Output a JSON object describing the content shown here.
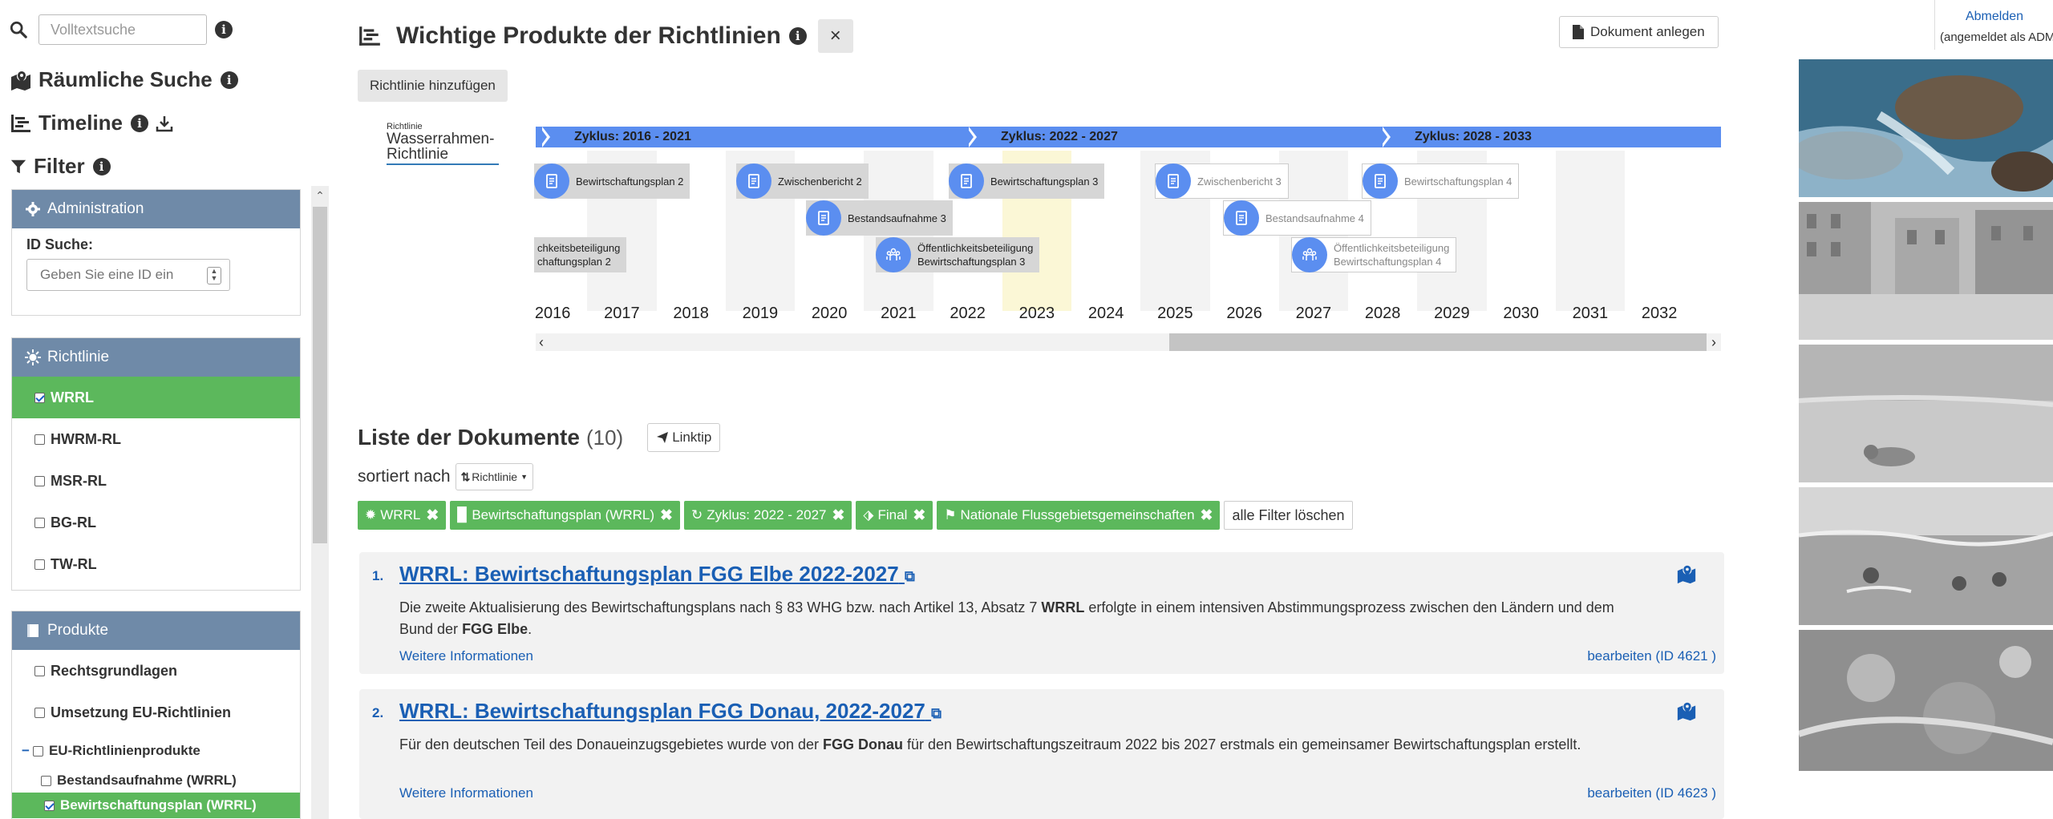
{
  "sidebar": {
    "search": {
      "placeholder": "Volltextsuche"
    },
    "spatial_search": "Räumliche Suche",
    "timeline": "Timeline",
    "filter": "Filter",
    "admin": {
      "title": "Administration",
      "id_label": "ID Suche:",
      "id_placeholder": "Geben Sie eine ID ein"
    },
    "richtlinie": {
      "title": "Richtlinie",
      "items": [
        {
          "label": "WRRL",
          "checked": true
        },
        {
          "label": "HWRM-RL",
          "checked": false
        },
        {
          "label": "MSR-RL",
          "checked": false
        },
        {
          "label": "BG-RL",
          "checked": false
        },
        {
          "label": "TW-RL",
          "checked": false
        }
      ]
    },
    "produkte": {
      "title": "Produkte",
      "items": [
        {
          "label": "Rechtsgrundlagen",
          "checked": false
        },
        {
          "label": "Umsetzung EU-Richtlinien",
          "checked": false
        },
        {
          "label": "EU-Richtlinienprodukte",
          "checked": false,
          "collapse": "−"
        },
        {
          "label": "Bestandsaufnahme (WRRL)",
          "checked": false
        },
        {
          "label": "Bewirtschaftungsplan (WRRL)",
          "checked": true
        }
      ]
    }
  },
  "main": {
    "title": "Wichtige Produkte der Richtlinien",
    "close": "×",
    "new_doc": "Dokument anlegen",
    "add_directive": "Richtlinie hinzufügen",
    "timeline": {
      "label_small": "Richtlinie",
      "label_big": "Wasserrahmen-Richtlinie",
      "cycles": [
        "Zyklus: 2016 - 2021",
        "Zyklus: 2022 - 2027",
        "Zyklus: 2028 - 2033"
      ],
      "years": [
        "2016",
        "2017",
        "2018",
        "2019",
        "2020",
        "2021",
        "2022",
        "2023",
        "2024",
        "2025",
        "2026",
        "2027",
        "2028",
        "2029",
        "2030",
        "2031",
        "2032"
      ],
      "current_year": "2023",
      "items": [
        {
          "label": "Bewirtschaftungsplan 2",
          "icon": "doc-icon",
          "future": false
        },
        {
          "label": "Zwischenbericht 2",
          "icon": "doc-icon",
          "future": false
        },
        {
          "label": "Bestandsaufnahme 3",
          "icon": "doc-icon",
          "future": false
        },
        {
          "label": "Bewirtschaftungsplan 3",
          "icon": "doc-icon",
          "future": false
        },
        {
          "label": "Zwischenbericht 3",
          "icon": "doc-icon",
          "future": true
        },
        {
          "label": "Bestandsaufnahme 4",
          "icon": "doc-icon",
          "future": true
        },
        {
          "label": "Bewirtschaftungsplan 4",
          "icon": "doc-icon",
          "future": true
        },
        {
          "line1": "chkeitsbeteiligung",
          "line2": "chaftungsplan 2",
          "icon": "none",
          "future": false
        },
        {
          "line1": "Öffentlichkeitsbeteiligung",
          "line2": "Bewirtschaftungsplan 3",
          "icon": "people-icon",
          "future": false
        },
        {
          "line1": "Öffentlichkeitsbeteiligung",
          "line2": "Bewirtschaftungsplan 4",
          "icon": "people-icon",
          "future": true
        }
      ]
    },
    "list": {
      "title": "Liste der Dokumente",
      "count": "(10)",
      "linktip": "Linktip",
      "sorted_by": "sortiert nach",
      "sort_value": "Richtlinie",
      "chips": [
        "WRRL",
        "Bewirtschaftungsplan (WRRL)",
        "Zyklus: 2022 - 2027",
        "Final",
        "Nationale Flussgebietsgemeinschaften"
      ],
      "clear_filters": "alle Filter löschen",
      "docs": [
        {
          "num": "1.",
          "title": "WRRL: Bewirtschaftungsplan FGG Elbe 2022-2027",
          "desc_a": "Die zweite Aktualisierung des Bewirtschaftungsplans nach § 83 WHG bzw. nach Artikel 13, Absatz 7 ",
          "desc_b": "WRRL",
          "desc_c": " erfolgte in einem intensiven Abstimmungsprozess zwischen den Ländern und dem Bund der ",
          "desc_d": "FGG Elbe",
          "desc_e": ".",
          "more": "Weitere Informationen",
          "edit": "bearbeiten (ID 4621 )"
        },
        {
          "num": "2.",
          "title": "WRRL: Bewirtschaftungsplan FGG Donau, 2022-2027",
          "desc_a": "Für den deutschen Teil des Donaueinzugsgebietes wurde von der ",
          "desc_b": "FGG Donau",
          "desc_c": " für den Bewirtschaftungszeitraum 2022 bis 2027 erstmals ein gemeinsamer Bewirtschaftungsplan erstellt.",
          "desc_d": "",
          "desc_e": "",
          "more": "Weitere Informationen",
          "edit": "bearbeiten (ID 4623 )"
        }
      ]
    }
  },
  "account": {
    "logout": "Abmelden",
    "logged_in_as": "(angemeldet als ADMIN)"
  },
  "colors": {
    "panel_head": "#6f8aa8",
    "active_green": "#5cb85c",
    "timeline_blue": "#5b8ef0",
    "link_blue": "#1a5fb4"
  }
}
